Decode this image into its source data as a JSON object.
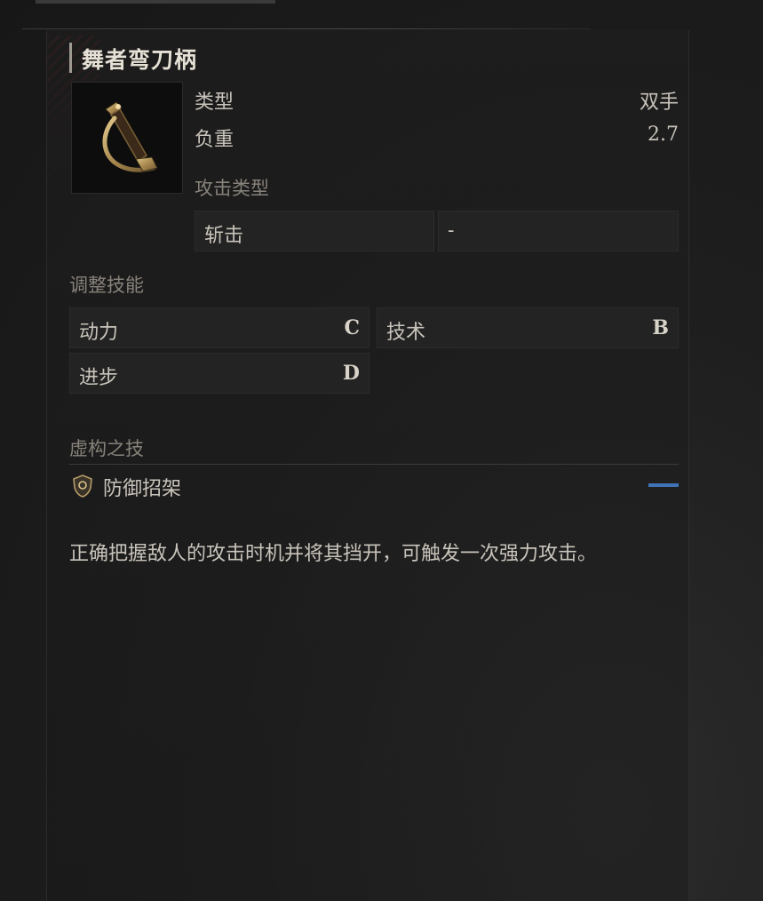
{
  "item": {
    "name": "舞者弯刀柄",
    "icon": "saber-hilt-icon"
  },
  "stats": {
    "type_label": "类型",
    "type_value": "双手",
    "weight_label": "负重",
    "weight_value": "2.7"
  },
  "attack_type": {
    "heading": "攻击类型",
    "primary": "斩击",
    "secondary": "-"
  },
  "scaling": {
    "heading": "调整技能",
    "items": [
      {
        "label": "动力",
        "grade": "C"
      },
      {
        "label": "技术",
        "grade": "B"
      },
      {
        "label": "进步",
        "grade": "D"
      }
    ]
  },
  "fable_art": {
    "heading": "虚构之技",
    "icon": "shield-icon",
    "name": "防御招架",
    "indicator_color": "#3f73b5"
  },
  "description": "正确把握敌人的攻击时机并将其挡开，可触发一次强力攻击。"
}
